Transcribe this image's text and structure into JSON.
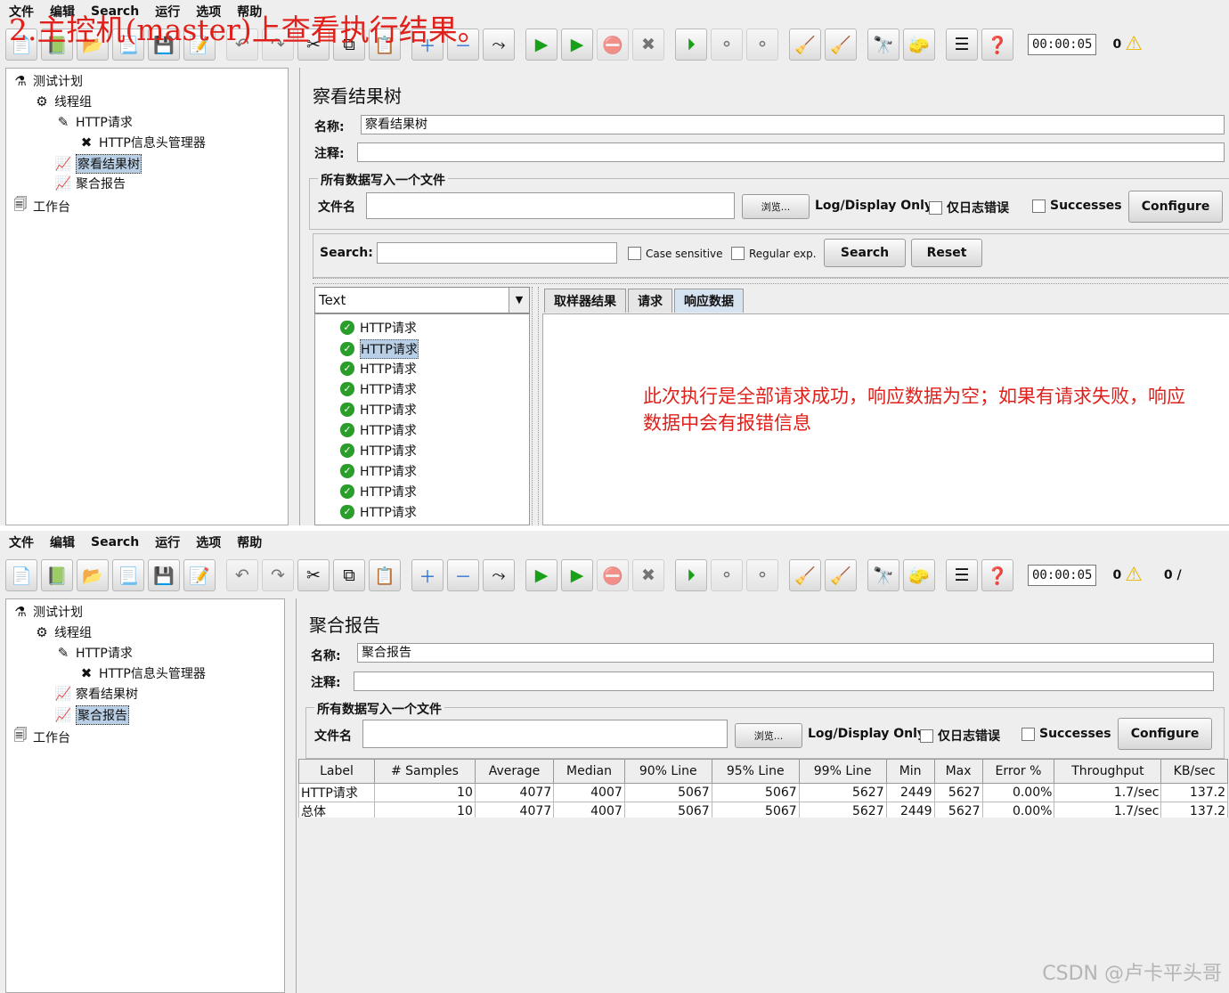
{
  "heading": "2.主控机(master)上查看执行结果。",
  "menu": [
    "文件",
    "编辑",
    "Search",
    "运行",
    "选项",
    "帮助"
  ],
  "toolbar": {
    "timer": "00:00:05",
    "error_count": "0",
    "extra_count": "0 /"
  },
  "tree": {
    "test_plan": "测试计划",
    "thread_group": "线程组",
    "http_request": "HTTP请求",
    "header_manager": "HTTP信息头管理器",
    "results_tree": "察看结果树",
    "aggregate_report": "聚合报告",
    "workbench": "工作台"
  },
  "view_results": {
    "title": "察看结果树",
    "name_label": "名称:",
    "name_value": "察看结果树",
    "comment_label": "注释:",
    "group_title": "所有数据写入一个文件",
    "filename_label": "文件名",
    "browse_label": "浏览...",
    "log_display_label": "Log/Display Only:",
    "errors_only_label": "仅日志错误",
    "successes_label": "Successes",
    "configure_label": "Configure",
    "search_label": "Search:",
    "case_sensitive_label": "Case sensitive",
    "regex_label": "Regular exp.",
    "search_button": "Search",
    "reset_button": "Reset",
    "renderer": "Text",
    "samples": [
      "HTTP请求",
      "HTTP请求",
      "HTTP请求",
      "HTTP请求",
      "HTTP请求",
      "HTTP请求",
      "HTTP请求",
      "HTTP请求",
      "HTTP请求",
      "HTTP请求"
    ],
    "tabs": [
      "取样器结果",
      "请求",
      "响应数据"
    ],
    "annotation": "此次执行是全部请求成功，响应数据为空；如果有请求失败，响应数据中会有报错信息"
  },
  "aggregate": {
    "title": "聚合报告",
    "name_label": "名称:",
    "name_value": "聚合报告",
    "comment_label": "注释:",
    "group_title": "所有数据写入一个文件",
    "filename_label": "文件名",
    "browse_label": "浏览...",
    "log_display_label": "Log/Display Only:",
    "errors_only_label": "仅日志错误",
    "successes_label": "Successes",
    "configure_label": "Configure",
    "columns": [
      "Label",
      "# Samples",
      "Average",
      "Median",
      "90% Line",
      "95% Line",
      "99% Line",
      "Min",
      "Max",
      "Error %",
      "Throughput",
      "KB/sec"
    ],
    "rows": [
      [
        "HTTP请求",
        "10",
        "4077",
        "4007",
        "5067",
        "5067",
        "5627",
        "2449",
        "5627",
        "0.00%",
        "1.7/sec",
        "137.2"
      ],
      [
        "总体",
        "10",
        "4077",
        "4007",
        "5067",
        "5067",
        "5627",
        "2449",
        "5627",
        "0.00%",
        "1.7/sec",
        "137.2"
      ]
    ]
  },
  "watermark": "CSDN @卢卡平头哥"
}
